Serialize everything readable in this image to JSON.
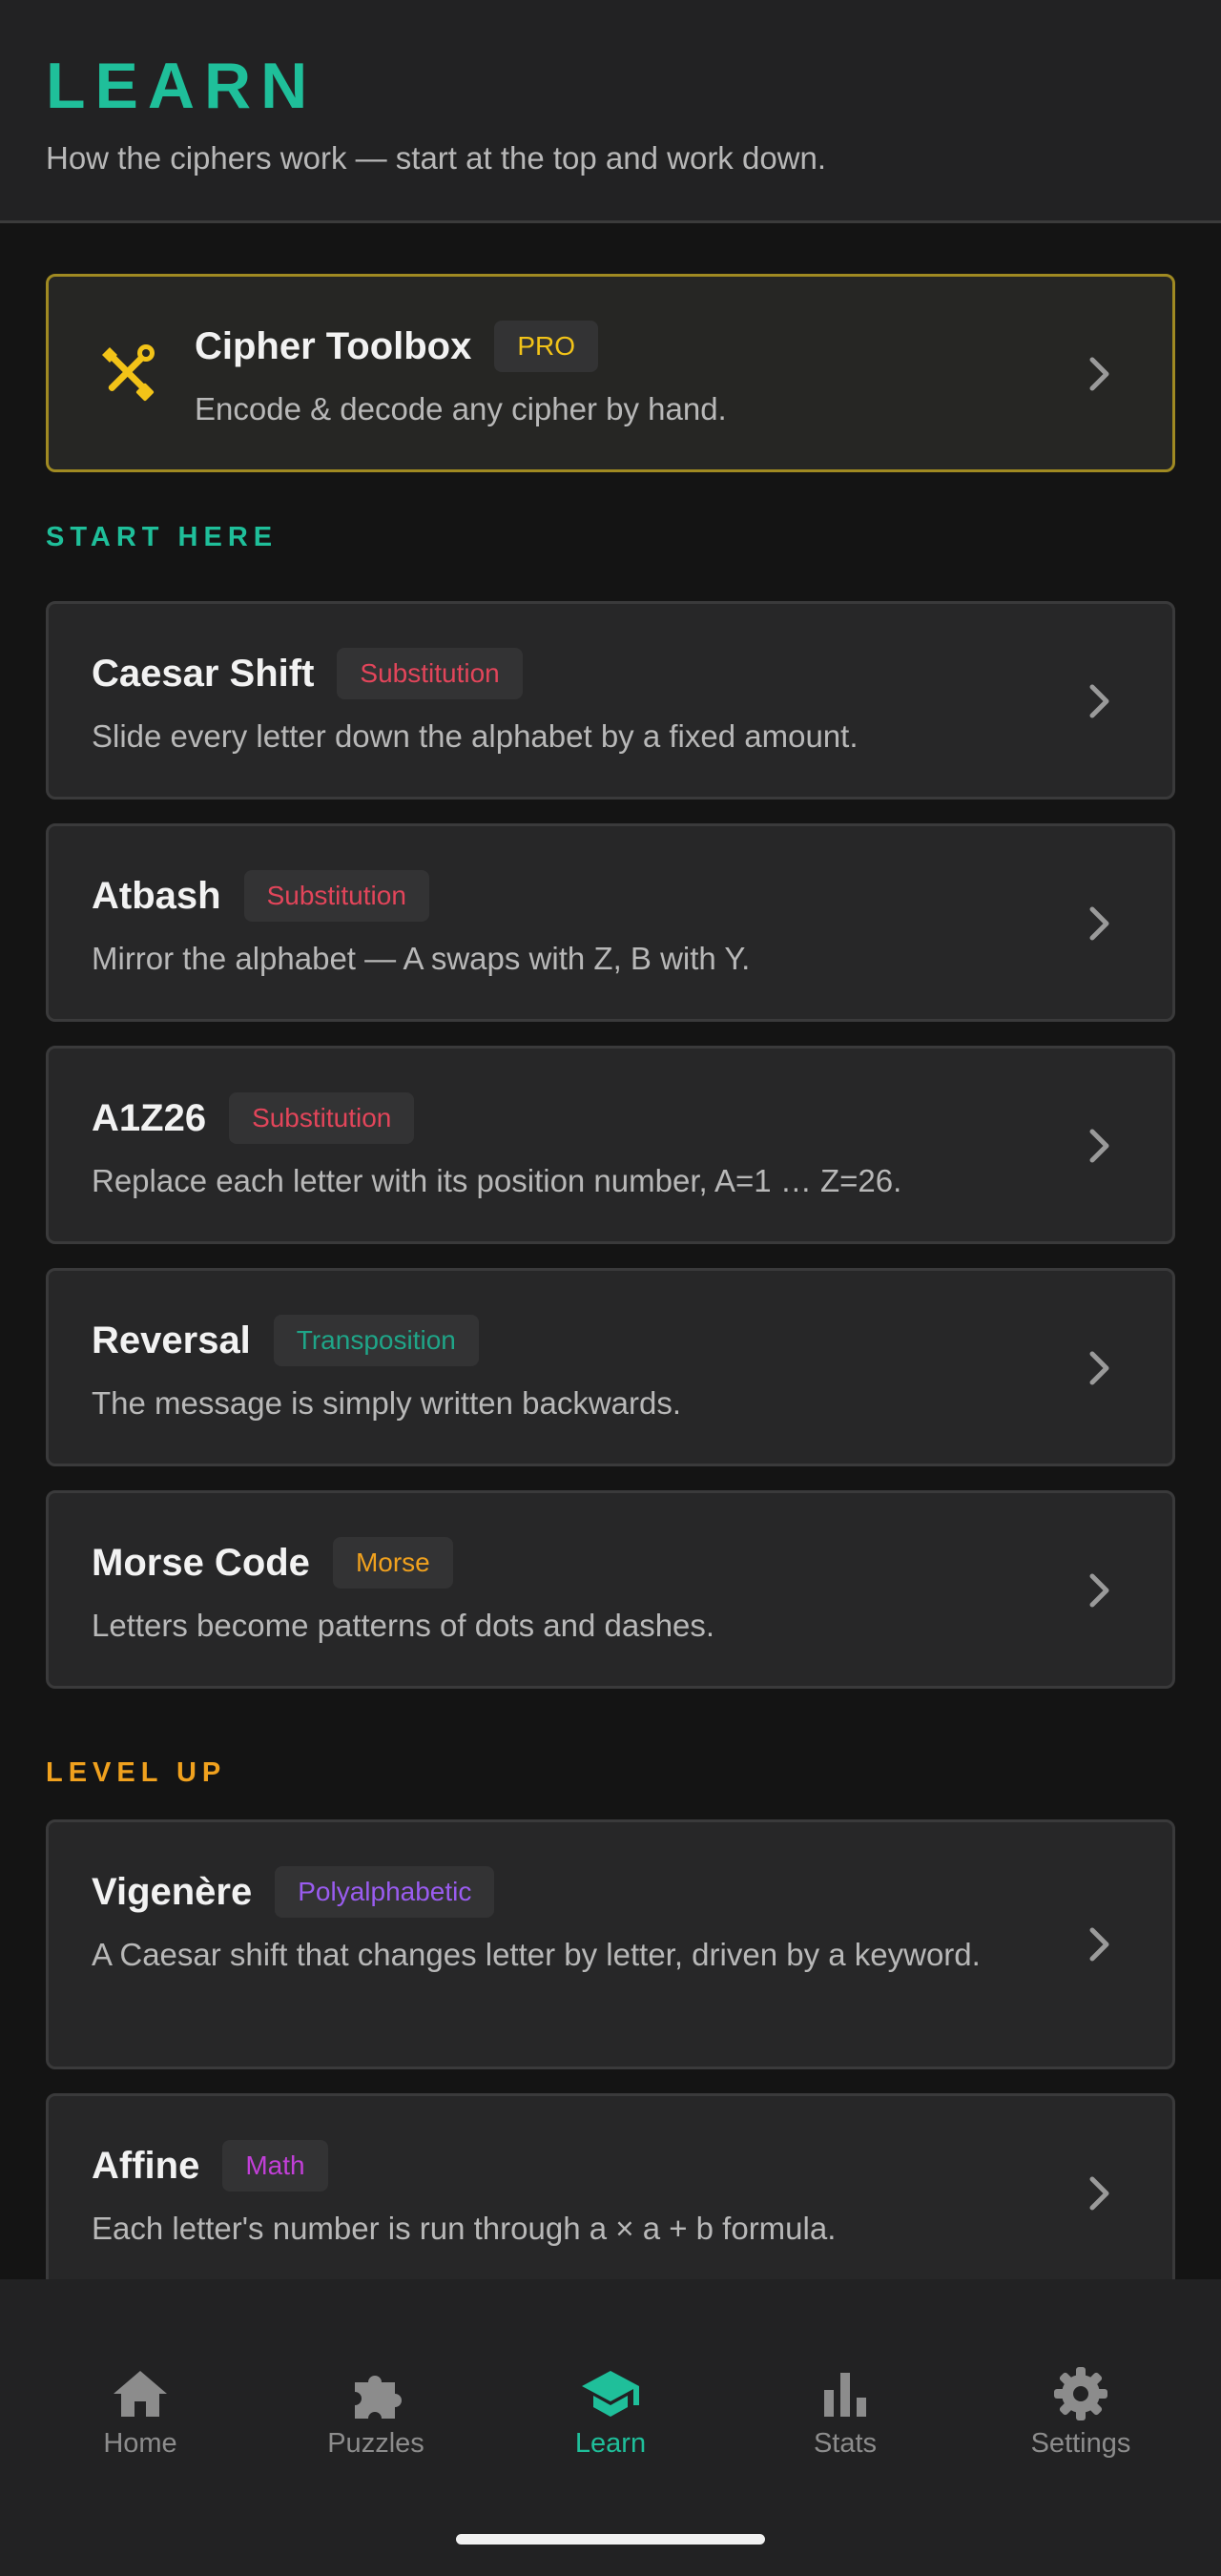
{
  "header": {
    "title": "LEARN",
    "subtitle": "How the ciphers work — start at the top and work down."
  },
  "toolbox": {
    "title": "Cipher Toolbox",
    "badge": "PRO",
    "description": "Encode & decode any cipher by hand.",
    "icon": "tools-icon"
  },
  "sections": {
    "start": "START HERE",
    "levelup": "LEVEL UP"
  },
  "ciphers": [
    {
      "title": "Caesar Shift",
      "badge": "Substitution",
      "description": "Slide every letter down the alphabet by a fixed amount."
    },
    {
      "title": "Atbash",
      "badge": "Substitution",
      "description": "Mirror the alphabet — A swaps with Z, B with Y."
    },
    {
      "title": "A1Z26",
      "badge": "Substitution",
      "description": "Replace each letter with its position number, A=1 … Z=26."
    },
    {
      "title": "Reversal",
      "badge": "Transposition",
      "description": "The message is simply written backwards."
    },
    {
      "title": "Morse Code",
      "badge": "Morse",
      "description": "Letters become patterns of dots and dashes."
    },
    {
      "title": "Vigenère",
      "badge": "Polyalphabetic",
      "description": "A Caesar shift that changes letter by letter, driven by a keyword."
    },
    {
      "title": "Affine",
      "badge": "Math",
      "description": "Each letter's number is run through a × a + b formula."
    }
  ],
  "nav": [
    {
      "label": "Home",
      "icon": "home-icon"
    },
    {
      "label": "Puzzles",
      "icon": "puzzle-icon"
    },
    {
      "label": "Learn",
      "icon": "graduation-cap-icon",
      "active": true
    },
    {
      "label": "Stats",
      "icon": "bar-chart-icon"
    },
    {
      "label": "Settings",
      "icon": "gear-icon"
    }
  ],
  "colors": {
    "accent": "#1fbf9a",
    "levelup": "#f0a11e",
    "pro": "#f2c318",
    "substitution": "#e2455a",
    "transposition": "#1fa588",
    "morse": "#f0a11e",
    "polyalphabetic": "#9a5cf0",
    "math": "#c23fd8"
  }
}
